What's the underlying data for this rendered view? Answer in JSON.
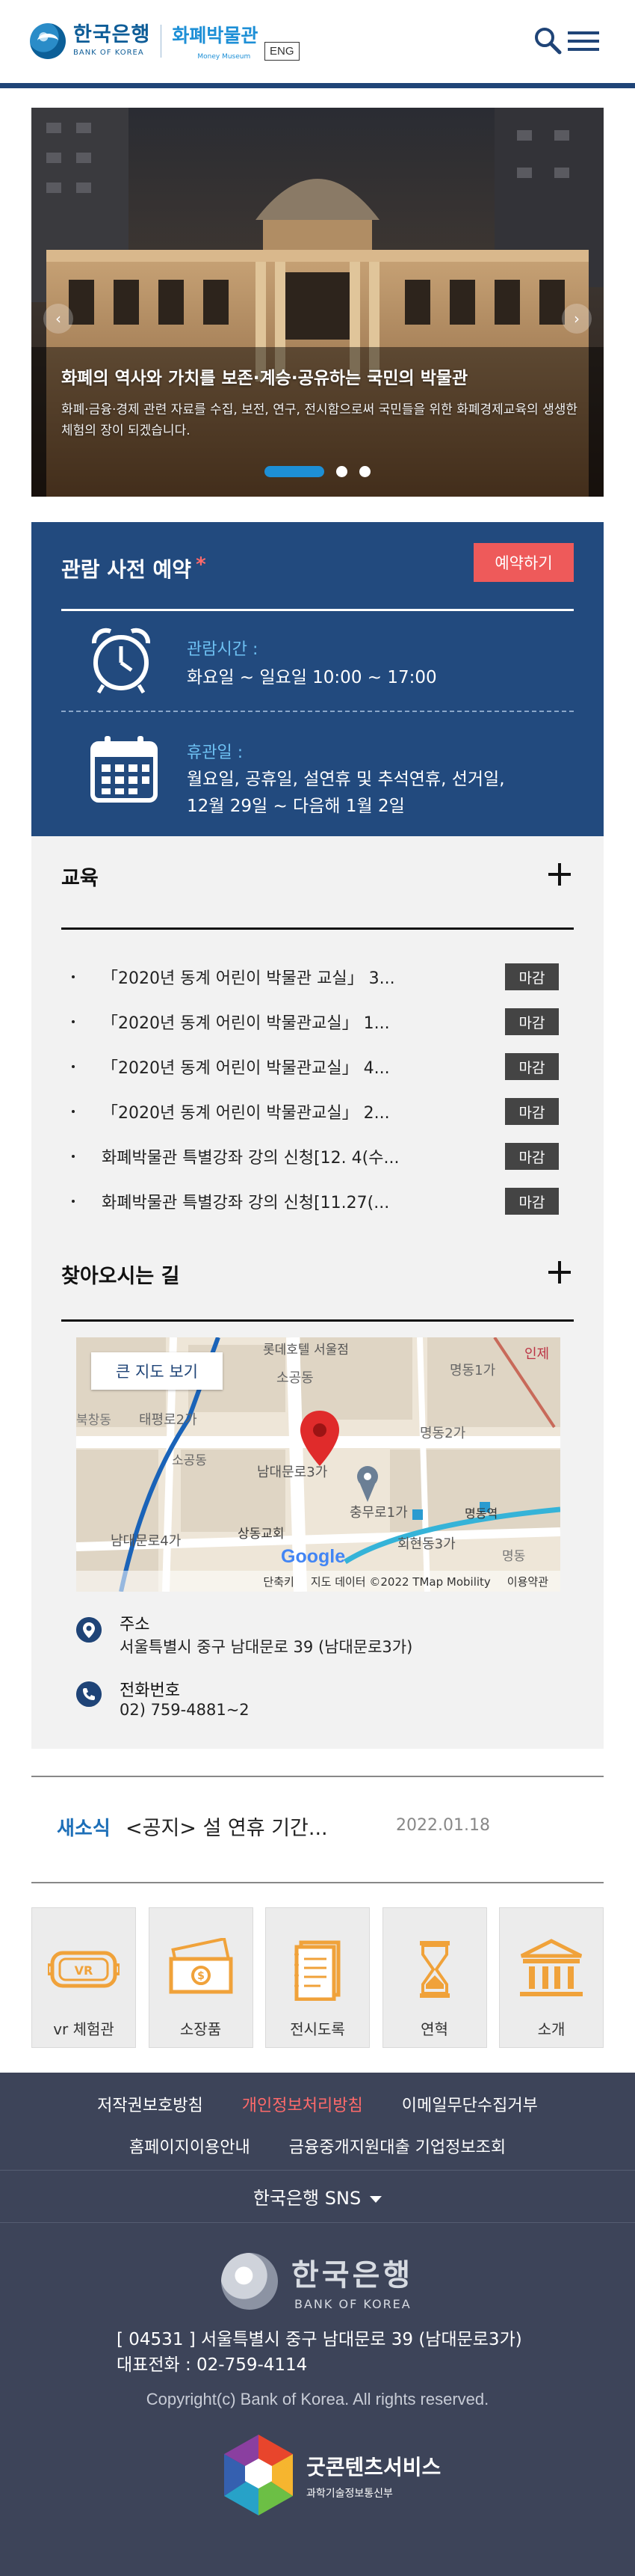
{
  "header": {
    "logo_ko": "한국은행",
    "logo_en": "BANK OF KOREA",
    "museum_ko": "화폐박물관",
    "museum_en": "Money Museum",
    "lang_button": "ENG"
  },
  "hero": {
    "title": "화폐의 역사와 가치를 보존·계승·공유하는 국민의 박물관",
    "description": "화폐·금융·경제 관련 자료를 수집, 보전, 연구, 전시함으로써 국민들을 위한 화폐경제교육의 생생한 체험의 장이 되겠습니다.",
    "prev_icon": "‹",
    "next_icon": "›"
  },
  "reservation": {
    "title": "관람 사전 예약",
    "star": "*",
    "button": "예약하기",
    "hours_label": "관람시간 :",
    "hours_value": "화요일 ~ 일요일 10:00 ~ 17:00",
    "closed_label": "휴관일 :",
    "closed_line1": "월요일, 공휴일, 설연휴 및 추석연휴, 선거일,",
    "closed_line2": "12월 29일 ~ 다음해 1월 2일"
  },
  "education": {
    "title": "교육",
    "items": [
      {
        "text": "「2020년 동계 어린이 박물관 교실」 3...",
        "badge": "마감"
      },
      {
        "text": "「2020년 동계 어린이 박물관교실」 1...",
        "badge": "마감"
      },
      {
        "text": "「2020년 동계 어린이 박물관교실」 4...",
        "badge": "마감"
      },
      {
        "text": "「2020년 동계 어린이 박물관교실」 2...",
        "badge": "마감"
      },
      {
        "text": "화폐박물관 특별강좌 강의 신청[12. 4(수...",
        "badge": "마감"
      },
      {
        "text": "화폐박물관 특별강좌 강의 신청[11.27(...",
        "badge": "마감"
      }
    ]
  },
  "directions": {
    "title": "찾아오시는 길",
    "map_button": "큰 지도 보기",
    "map_labels": {
      "lotte": "롯데호텔 서울점",
      "sogong1": "소공동",
      "sogong2": "소공동",
      "myeongdong1": "명동1가",
      "myeongdong2": "명동2가",
      "taepyeong": "태평로2가",
      "namdaemun3": "남대문로3가",
      "namdaemun4": "남대문로4가",
      "chungmu": "충무로1가",
      "hoehyeon": "회현동3가",
      "sangdong": "상동교회",
      "myeongdong_stn": "명동역",
      "injae": "인제",
      "myeongdong3": "명동",
      "bukchang": "북창동"
    },
    "map_google": "Google",
    "map_footer": [
      "단축키",
      "지도 데이터 ©2022 TMap Mobility",
      "이용약관"
    ],
    "address_label": "주소",
    "address_value": "서울특별시 중구 남대문로 39 (남대문로3가)",
    "phone_label": "전화번호",
    "phone_value": "02) 759-4881~2"
  },
  "news": {
    "label": "새소식",
    "text": "<공지> 설 연휴 기간...",
    "date": "2022.01.18"
  },
  "quick_menu": [
    {
      "label": "vr 체험관",
      "icon": "vr-goggles-icon"
    },
    {
      "label": "소장품",
      "icon": "banknote-icon"
    },
    {
      "label": "전시도록",
      "icon": "catalog-icon"
    },
    {
      "label": "연혁",
      "icon": "hourglass-icon"
    },
    {
      "label": "소개",
      "icon": "building-icon"
    }
  ],
  "footer": {
    "links_row1": [
      "저작권보호방침",
      "개인정보처리방침",
      "이메일무단수집거부"
    ],
    "links_row2": [
      "홈페이지이용안내",
      "금융중개지원대출 기업정보조회"
    ],
    "sns": "한국은행 SNS",
    "logo_ko": "한국은행",
    "logo_en": "BANK OF KOREA",
    "address": "[ 04531 ] 서울특별시 중구 남대문로 39 (남대문로3가)",
    "phone": "대표전화 : 02-759-4114",
    "copyright": "Copyright(c) Bank of Korea. All rights reserved.",
    "gc_title": "굿콘텐츠서비스",
    "gc_sub": "과학기술정보통신부"
  },
  "colors": {
    "navy": "#224a7e",
    "accent_blue": "#1d8fd6",
    "red_button": "#ee5a5a",
    "orange_icon": "#f0a23a",
    "footer_bg": "#3d4459"
  }
}
